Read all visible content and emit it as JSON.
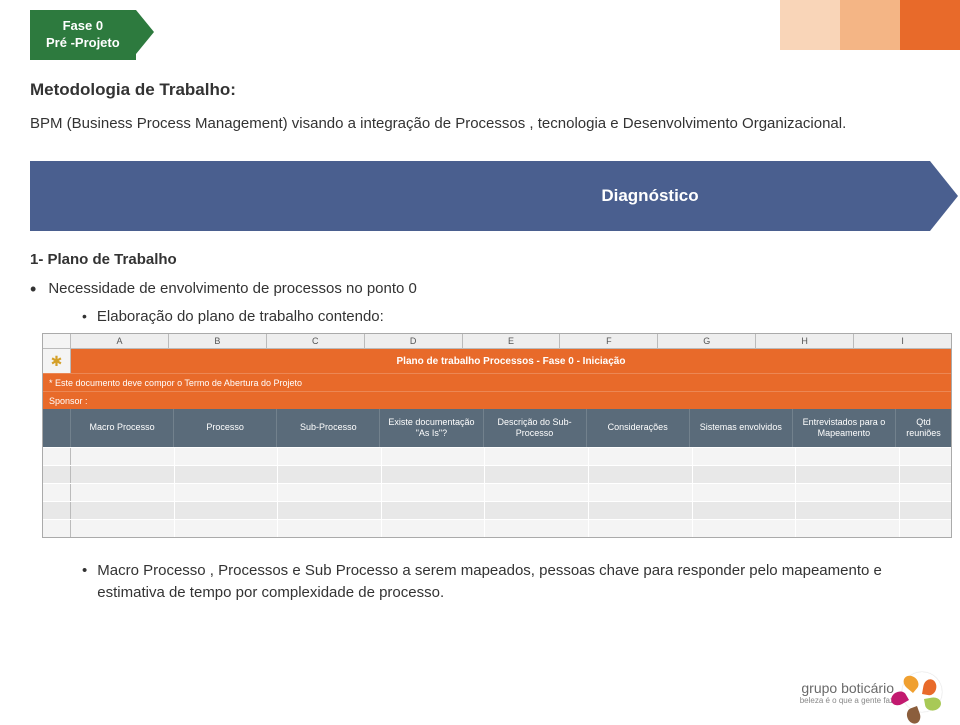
{
  "badge": {
    "line1": "Fase 0",
    "line2": "Pré -Projeto"
  },
  "heading": "Metodologia de Trabalho:",
  "subheading": "BPM (Business Process Management) visando a integração de Processos , tecnologia e Desenvolvimento Organizacional.",
  "diag_label": "Diagnóstico",
  "section": "1- Plano de Trabalho",
  "bullet1": "Necessidade de envolvimento de processos no ponto 0",
  "sub_bullet1": "Elaboração do plano de trabalho contendo:",
  "spreadsheet": {
    "cols": [
      "A",
      "B",
      "C",
      "D",
      "E",
      "F",
      "G",
      "H",
      "I"
    ],
    "title": "Plano de trabalho Processos - Fase 0 - Iniciação",
    "note": "* Este documento deve compor o Termo de Abertura do Projeto",
    "sponsor": "Sponsor :",
    "headers": [
      "Macro Processo",
      "Processo",
      "Sub-Processo",
      "Existe documentação \"As Is\"?",
      "Descrição do Sub-Processo",
      "Considerações",
      "Sistemas envolvidos",
      "Entrevistados para o Mapeamento",
      "Qtd reuniões"
    ]
  },
  "lower_bullet": "Macro Processo , Processos e Sub Processo a serem mapeados, pessoas chave para responder pelo mapeamento e estimativa de tempo por complexidade de processo.",
  "footer": {
    "brand": "grupo boticário",
    "tag": "beleza é o que a gente faz"
  }
}
